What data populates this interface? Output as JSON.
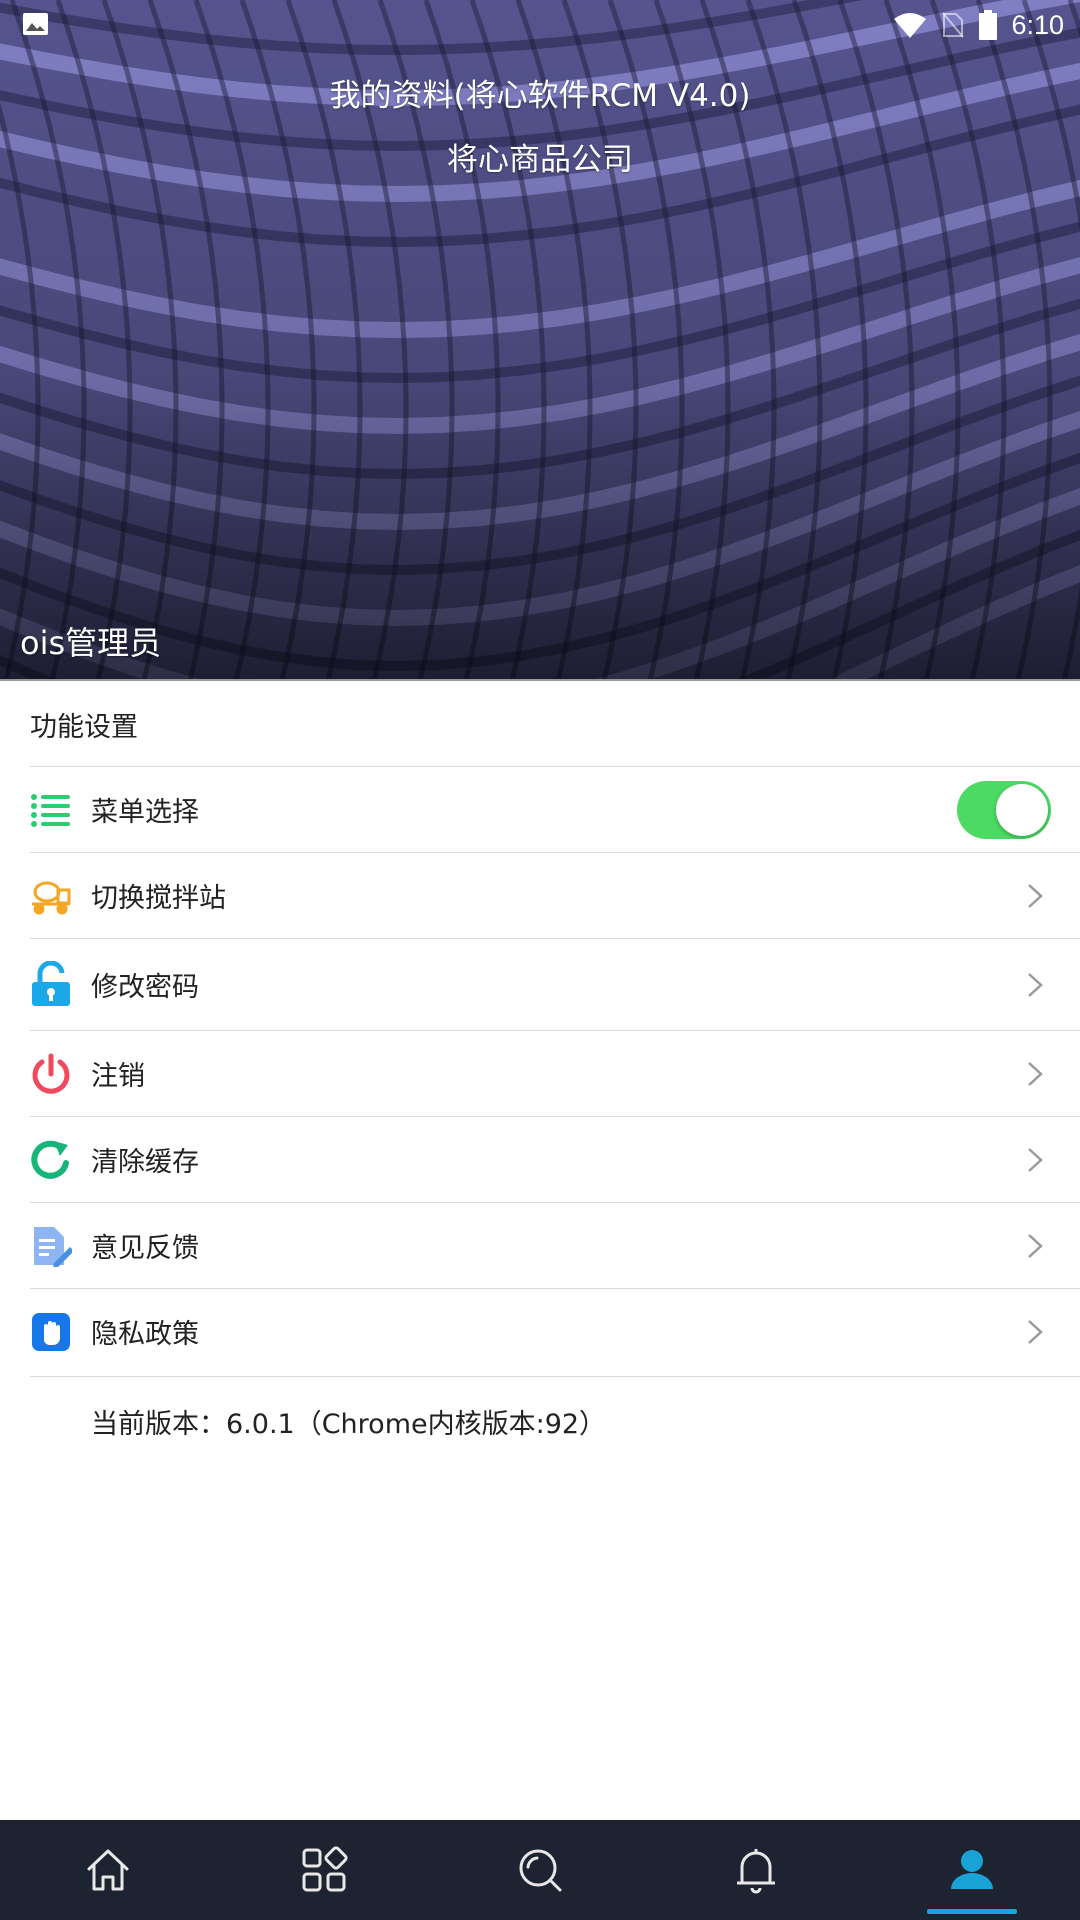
{
  "status_bar": {
    "time": "6:10",
    "icons": [
      "gallery-icon",
      "wifi-icon",
      "no-sim-icon",
      "battery-icon"
    ]
  },
  "header": {
    "title": "我的资料(将心软件RCM V4.0)",
    "company": "将心商品公司",
    "user_name": "ois管理员"
  },
  "section": {
    "title": "功能设置"
  },
  "settings": {
    "items": [
      {
        "label": "菜单选择",
        "icon": "list-icon",
        "control": "toggle",
        "toggle_on": true,
        "icon_color": "#2ecc71"
      },
      {
        "label": "切换搅拌站",
        "icon": "mixer-truck-icon",
        "control": "chevron",
        "icon_color": "#f5a623"
      },
      {
        "label": "修改密码",
        "icon": "unlock-icon",
        "control": "chevron",
        "icon_color": "#1ba8e8"
      },
      {
        "label": "注销",
        "icon": "power-icon",
        "control": "chevron",
        "icon_color": "#ef4a5e"
      },
      {
        "label": "清除缓存",
        "icon": "refresh-icon",
        "control": "chevron",
        "icon_color": "#18b57a"
      },
      {
        "label": "意见反馈",
        "icon": "feedback-doc-icon",
        "control": "chevron",
        "icon_color": "#4a90e2"
      },
      {
        "label": "隐私政策",
        "icon": "hand-stop-icon",
        "control": "chevron",
        "icon_color": "#1677e8"
      }
    ]
  },
  "version": {
    "text": "当前版本：6.0.1（Chrome内核版本:92）"
  },
  "bottom_nav": {
    "items": [
      {
        "icon": "home-icon",
        "active": false
      },
      {
        "icon": "apps-grid-icon",
        "active": false
      },
      {
        "icon": "search-icon",
        "active": false
      },
      {
        "icon": "bell-icon",
        "active": false
      },
      {
        "icon": "user-icon",
        "active": true
      }
    ],
    "active_color": "#1aa3d6"
  }
}
